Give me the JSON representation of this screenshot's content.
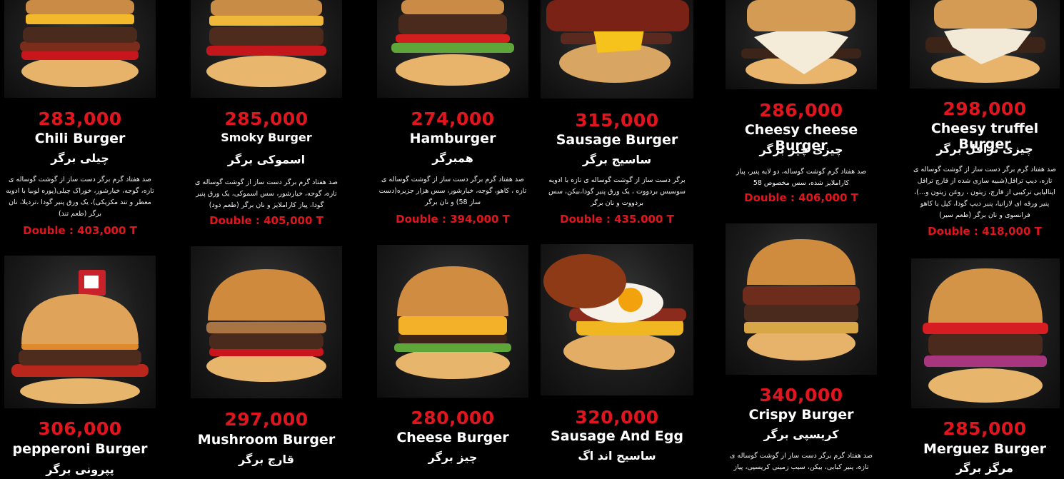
{
  "menu": {
    "currency_color": "#e0151e",
    "items": [
      {
        "price": "283,000",
        "name_en": "Chili Burger",
        "name_fa": "چیلی برگر",
        "desc": "صد هفتاد گرم برگر دست ساز از گوشت گوساله ی تازه، گوجه، خیارشور، خوراک چیلی(پوره لوبیا با ادویه معطر و تند مکزیکی)، یک ورق پنیر گودا ،تردیلا، نان برگر (طعم تند)",
        "double": "Double : 403,000 T",
        "image_icon": "burger-photo"
      },
      {
        "price": "285,000",
        "name_en": "Smoky Burger",
        "name_fa": "اسموکی برگر",
        "desc": "صد هفتاد گرم برگر دست ساز از گوشت گوساله ی تازه، گوجه، خیارشور، سس اسموکی، یک ورق پنیر گودا، پیاز کاراملایز و نان برگر (طعم دود)",
        "double": "Double : 405,000 T",
        "image_icon": "burger-photo"
      },
      {
        "price": "274,000",
        "name_en": "Hamburger",
        "name_fa": "همبرگر",
        "desc": "صد هفتاد گرم برگر دست ساز از گوشت گوساله ی تازه ، کاهو، گوجه، خیارشور، سس هزار جزیره(دست ساز 58) و نان برگر",
        "double": "Double : 394,000 T",
        "image_icon": "burger-photo"
      },
      {
        "price": "315,000",
        "name_en": "Sausage Burger",
        "name_fa": "ساسیج برگر",
        "desc": "برگر دست ساز از گوشت گوساله ی تازه با ادویه سوسیس بردووت ، یک ورق پنیر گودا،بیکن، سس بردووت و نان برگر",
        "double": "Double : 435.000 T",
        "image_icon": "burger-photo"
      },
      {
        "price": "286,000",
        "name_en": "Cheesy cheese Burger",
        "name_fa": "چیزی چیز برگر",
        "desc": "صد هفتاد گرم گوشت گوساله، دو لایه پنیر، پیاز کاراملایز شده، سس مخصوص 58",
        "double": "Double : 406,000 T",
        "image_icon": "burger-photo"
      },
      {
        "price": "298,000",
        "name_en": "Cheesy truffel Burger",
        "name_fa": "چیزی ترافل برگر",
        "desc": "صد هفتاد گرم برگر دست ساز از گوشت گوساله ی تازه، دیپ ترافل(شبیه سازی شده از قارچ ترافل ایتالیایی ترکیبی از قارچ، زیتون ، روغن زیتون و...)، پنیر ورقه ای لازانیا، پنیر دیپ گودا، کپل یا کاهو فرانسوی و نان برگر (طعم سیر)",
        "double": "Double : 418,000 T",
        "image_icon": "burger-photo"
      },
      {
        "price": "306,000",
        "name_en": "pepperoni Burger",
        "name_fa": "پپرونی برگر",
        "image_icon": "burger-photo"
      },
      {
        "price": "297,000",
        "name_en": "Mushroom Burger",
        "name_fa": "قارچ برگر",
        "image_icon": "burger-photo"
      },
      {
        "price": "280,000",
        "name_en": "Cheese Burger",
        "name_fa": "چیز برگر",
        "image_icon": "burger-photo"
      },
      {
        "price": "320,000",
        "name_en": "Sausage And Egg",
        "name_fa": "ساسیج اند اگ",
        "image_icon": "burger-photo"
      },
      {
        "price": "340,000",
        "name_en": "Crispy Burger",
        "name_fa": "کریسپی برگر",
        "desc": "صد هفتاد گرم برگر دست ساز از گوشت گوساله ی تازه، پنیر کبابی، بیکن، سیب زمینی کریسپی، پیاز",
        "image_icon": "burger-photo"
      },
      {
        "price": "285,000",
        "name_en": "Merguez Burger",
        "name_fa": "مرگز برگر",
        "image_icon": "burger-photo"
      }
    ]
  }
}
